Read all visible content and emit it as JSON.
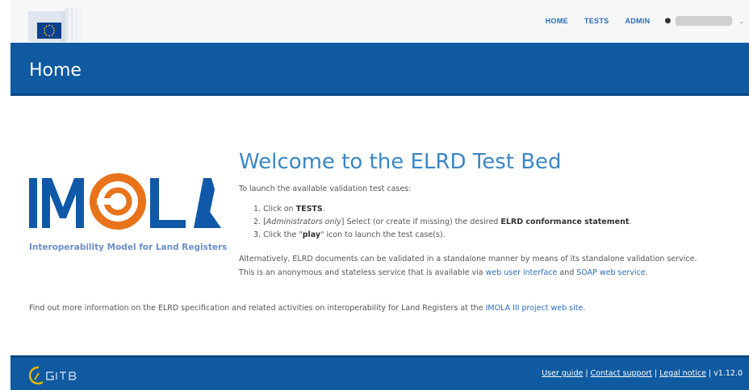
{
  "nav": {
    "home": "HOME",
    "tests": "TESTS",
    "admin": "ADMIN"
  },
  "header": {
    "title": "Home"
  },
  "logo": {
    "subtitle": "Interoperability Model for Land Registers"
  },
  "content": {
    "welcome": "Welcome to the ELRD Test Bed",
    "intro": "To launch the available validation test cases:",
    "step1_pre": "1. Click on ",
    "step1_bold": "TESTS",
    "step1_post": ".",
    "step2_pre": "2. [",
    "step2_italic": "Administrators only",
    "step2_mid": "] Select (or create if missing) the desired ",
    "step2_bold": "ELRD conformance statement",
    "step2_post": ".",
    "step3_pre": "3. Click the \"",
    "step3_bold": "play",
    "step3_post": "\" icon to launch the test case(s).",
    "alt_line1": "Alternatively, ELRD documents can be validated in a standalone manner by means of its standalone validation service.",
    "alt_line2_pre": "This is an anonymous and stateless service that is available via ",
    "link_web_ui": "web user interface",
    "alt_and": " and ",
    "link_soap": "SOAP web service",
    "alt_end": ".",
    "more_pre": "Find out more information on the ELRD specification and related activities on interoperability for Land Registers at the ",
    "link_imola": "IMOLA III project web site",
    "more_end": "."
  },
  "footer": {
    "user_guide": "User guide",
    "contact": "Contact support",
    "legal": "Legal notice",
    "sep": "|",
    "version": "v1.12.0"
  },
  "colors": {
    "brand_blue": "#0f5aa0",
    "link_blue": "#2a6ebb",
    "imola_orange": "#e8731a"
  }
}
